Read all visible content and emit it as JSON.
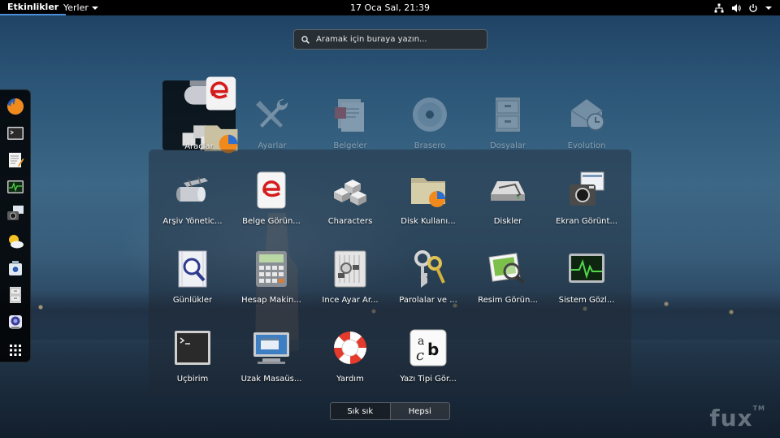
{
  "topbar": {
    "activities": "Etkinlikler",
    "places": "Yerler",
    "clock": "17 Oca Sal, 21:39",
    "status_icons": [
      "network-icon",
      "volume-icon",
      "power-icon"
    ]
  },
  "search": {
    "placeholder": "Aramak için buraya yazın..."
  },
  "dash": {
    "items": [
      "firefox",
      "terminal",
      "text-editor",
      "system-monitor",
      "screenshot",
      "weather",
      "camera",
      "files",
      "cheese"
    ],
    "show_apps_icon": "grid-icon"
  },
  "top_row": [
    {
      "label": "Araçlar",
      "state": "selected-folder"
    },
    {
      "label": "Ayarlar",
      "state": "dimmed"
    },
    {
      "label": "Belgeler",
      "state": "dimmed"
    },
    {
      "label": "Brasero",
      "state": "dimmed"
    },
    {
      "label": "Dosyalar",
      "state": "dimmed"
    },
    {
      "label": "Evolution",
      "state": "dimmed"
    }
  ],
  "folder_apps": [
    {
      "label": "Arşiv Yönetic...",
      "icon": "archive-icon"
    },
    {
      "label": "Belge Görün...",
      "icon": "document-viewer-icon"
    },
    {
      "label": "Characters",
      "icon": "characters-icon"
    },
    {
      "label": "Disk Kullanı...",
      "icon": "disk-usage-icon"
    },
    {
      "label": "Diskler",
      "icon": "disks-icon"
    },
    {
      "label": "Ekran Görünt...",
      "icon": "screenshot-icon"
    },
    {
      "label": "Günlükler",
      "icon": "logs-icon"
    },
    {
      "label": "Hesap Makin...",
      "icon": "calculator-icon"
    },
    {
      "label": "İnce Ayar Ar...",
      "icon": "tweak-tool-icon"
    },
    {
      "label": "Parolalar ve ...",
      "icon": "passwords-icon"
    },
    {
      "label": "Resim Görün...",
      "icon": "image-viewer-icon"
    },
    {
      "label": "Sistem Gözl...",
      "icon": "system-monitor-icon"
    },
    {
      "label": "Uçbirim",
      "icon": "terminal-icon"
    },
    {
      "label": "Uzak Masaüs...",
      "icon": "remote-desktop-icon"
    },
    {
      "label": "Yardım",
      "icon": "help-icon"
    },
    {
      "label": "Yazı Tipi Gör...",
      "icon": "font-viewer-icon"
    }
  ],
  "switcher": {
    "frequent": "Sık sık",
    "all": "Hepsi",
    "active": "all"
  },
  "watermark": {
    "text": "fux",
    "tm": "TM"
  }
}
